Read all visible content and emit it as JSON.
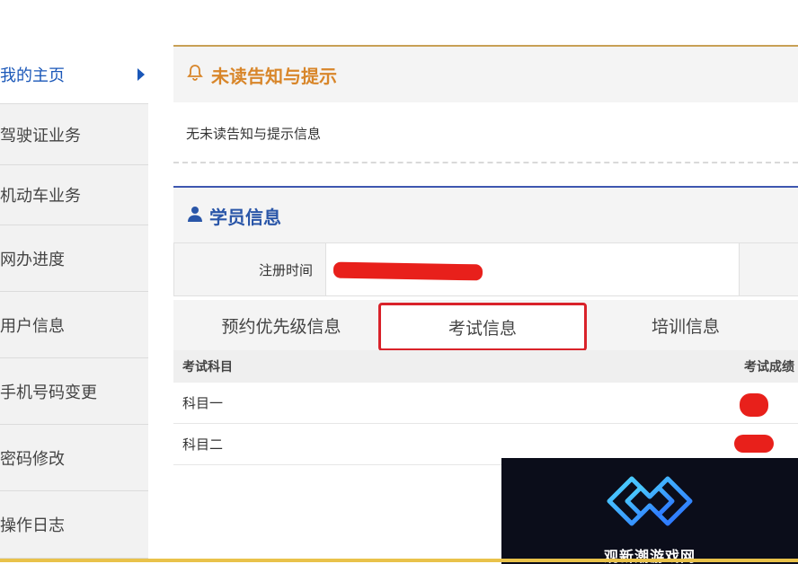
{
  "sidebar": {
    "items": [
      {
        "label": "我的主页",
        "active": true
      },
      {
        "label": "驾驶证业务"
      },
      {
        "label": "机动车业务"
      },
      {
        "label": "网办进度"
      },
      {
        "label": "用户信息"
      },
      {
        "label": "手机号码变更"
      },
      {
        "label": "密码修改"
      },
      {
        "label": "操作日志"
      }
    ]
  },
  "notice": {
    "title": "未读告知与提示",
    "body": "无未读告知与提示信息",
    "title_color": "#d8862a"
  },
  "student": {
    "title": "学员信息",
    "reg_label": "注册时间",
    "title_color": "#2a56a8"
  },
  "tabs": [
    {
      "label": "预约优先级信息"
    },
    {
      "label": "考试信息",
      "active": true
    },
    {
      "label": "培训信息"
    }
  ],
  "exam_table": {
    "columns": [
      "考试科目",
      "考试成绩"
    ],
    "rows": [
      {
        "subject": "科目一"
      },
      {
        "subject": "科目二"
      }
    ]
  },
  "watermark": {
    "text": "观新潮游戏网"
  },
  "colors": {
    "accent_red": "#d9222a",
    "redaction": "#e8201b",
    "nav_blue": "#1a57b8"
  }
}
